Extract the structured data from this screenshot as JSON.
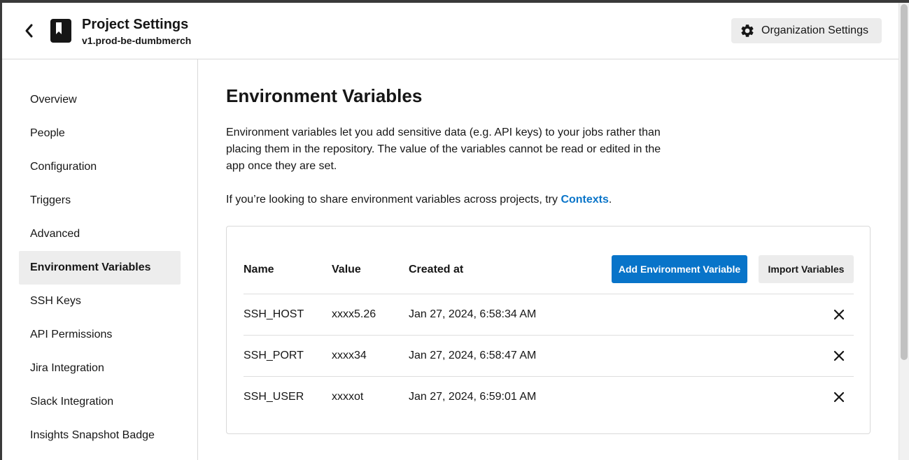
{
  "header": {
    "title": "Project Settings",
    "subtitle": "v1.prod-be-dumbmerch",
    "back_icon": "chevron-left-icon",
    "project_icon": "bookmark-icon",
    "org_button_label": "Organization Settings",
    "org_button_icon": "gear-icon"
  },
  "sidebar": {
    "items": [
      {
        "label": "Overview",
        "active": false
      },
      {
        "label": "People",
        "active": false
      },
      {
        "label": "Configuration",
        "active": false
      },
      {
        "label": "Triggers",
        "active": false
      },
      {
        "label": "Advanced",
        "active": false
      },
      {
        "label": "Environment Variables",
        "active": true
      },
      {
        "label": "SSH Keys",
        "active": false
      },
      {
        "label": "API Permissions",
        "active": false
      },
      {
        "label": "Jira Integration",
        "active": false
      },
      {
        "label": "Slack Integration",
        "active": false
      },
      {
        "label": "Insights Snapshot Badge",
        "active": false
      }
    ]
  },
  "main": {
    "heading": "Environment Variables",
    "description": "Environment variables let you add sensitive data (e.g. API keys) to your jobs rather than placing them in the repository. The value of the variables cannot be read or edited in the app once they are set.",
    "share_text": "If you’re looking to share environment variables across projects, try ",
    "share_link": "Contexts",
    "share_suffix": "."
  },
  "table": {
    "columns": {
      "name": "Name",
      "value": "Value",
      "created": "Created at"
    },
    "add_button": "Add Environment Variable",
    "import_button": "Import Variables",
    "delete_icon": "close-icon",
    "rows": [
      {
        "name": "SSH_HOST",
        "value": "xxxx5.26",
        "created": "Jan 27, 2024, 6:58:34 AM"
      },
      {
        "name": "SSH_PORT",
        "value": "xxxx34",
        "created": "Jan 27, 2024, 6:58:47 AM"
      },
      {
        "name": "SSH_USER",
        "value": "xxxxot",
        "created": "Jan 27, 2024, 6:59:01 AM"
      }
    ]
  },
  "colors": {
    "primary": "#0874c9",
    "link": "#0a75c9",
    "active_nav_bg": "#ededed"
  }
}
